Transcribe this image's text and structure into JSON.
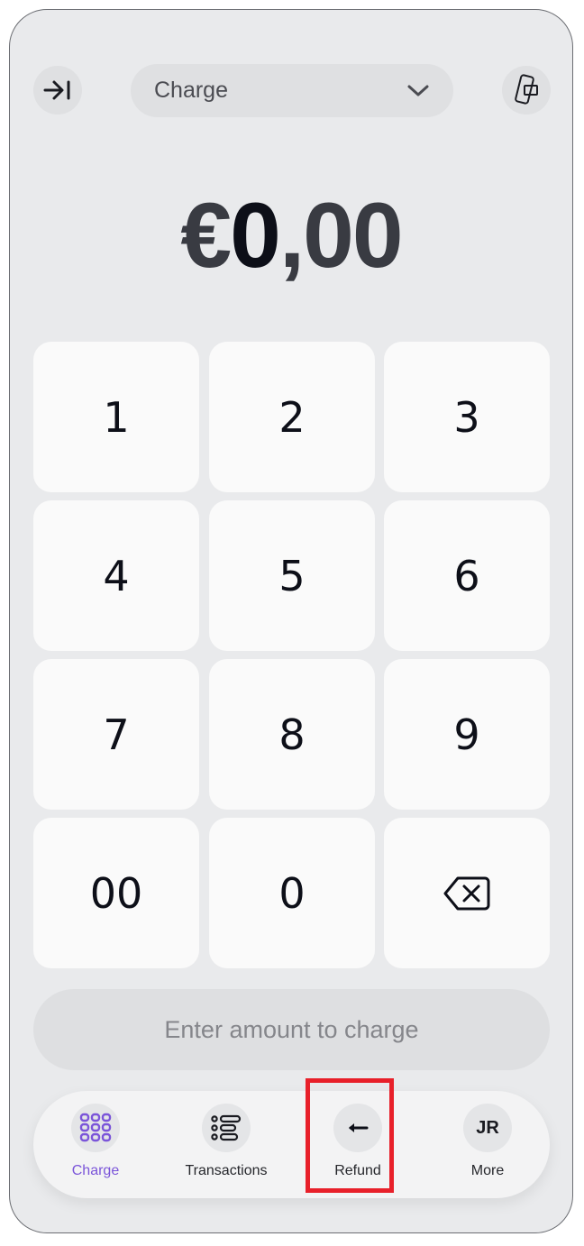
{
  "header": {
    "collapse_icon": "arrow-right-to-bar-icon",
    "mode_selector": {
      "value": "Charge",
      "icon": "chevron-down-icon"
    },
    "device_icon": "tap-to-pay-device-icon"
  },
  "amount": {
    "currency": "€",
    "integer": "0",
    "separator": ",",
    "decimals": "00"
  },
  "keypad": {
    "keys": [
      "1",
      "2",
      "3",
      "4",
      "5",
      "6",
      "7",
      "8",
      "9",
      "00",
      "0"
    ],
    "backspace_icon": "backspace-icon"
  },
  "charge_button": {
    "label": "Enter amount to charge"
  },
  "nav": {
    "items": [
      {
        "label": "Charge",
        "icon": "keypad-grid-icon",
        "active": true
      },
      {
        "label": "Transactions",
        "icon": "list-icon",
        "active": false
      },
      {
        "label": "Refund",
        "icon": "arrow-left-icon",
        "active": false
      },
      {
        "label": "More",
        "avatar_initials": "JR",
        "active": false
      }
    ]
  },
  "colors": {
    "accent": "#7b55d9",
    "background": "#e9eaec",
    "key_background": "#fafafa",
    "highlight": "#e8202a"
  }
}
